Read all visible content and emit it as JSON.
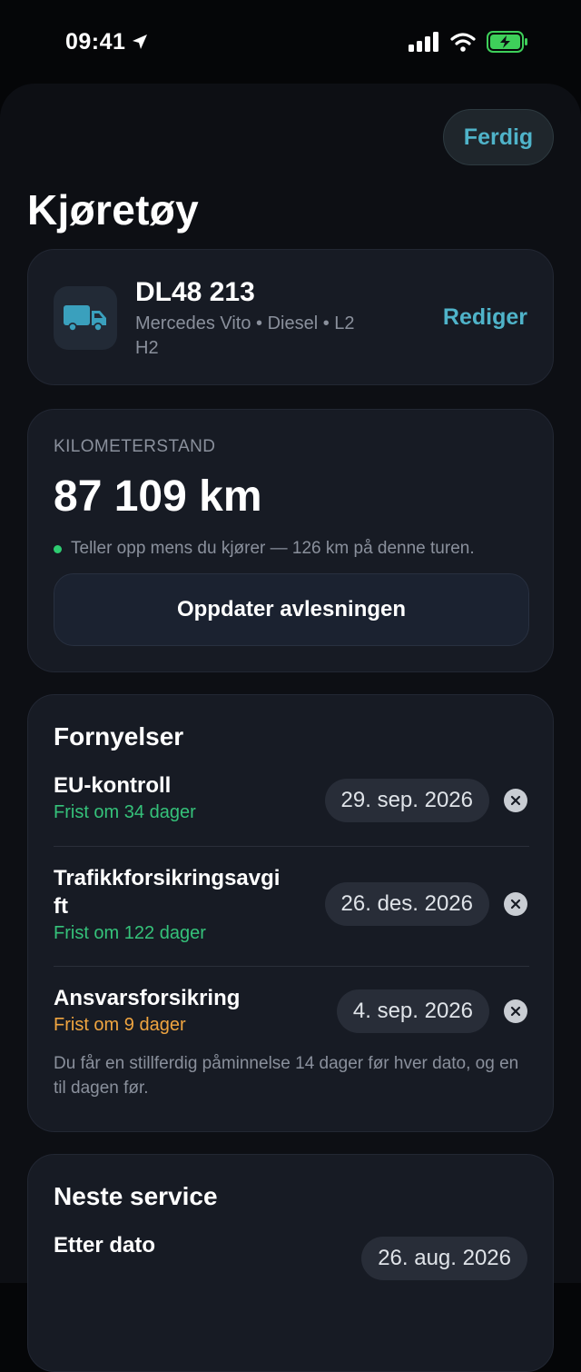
{
  "status_bar": {
    "time": "09:41"
  },
  "header": {
    "done_label": "Ferdig",
    "title": "Kjøretøy"
  },
  "vehicle": {
    "plate": "DL48 213",
    "description": "Mercedes Vito • Diesel • L2 H2",
    "edit_label": "Rediger",
    "accent_color": "#4fb3c9"
  },
  "odometer": {
    "label": "KILOMETERSTAND",
    "value": "87 109 km",
    "status": "Teller opp mens du kjører — 126 km på denne turen.",
    "update_label": "Oppdater avlesningen"
  },
  "renewals": {
    "title": "Fornyelser",
    "items": [
      {
        "name": "EU-kontroll",
        "due": "Frist om 34 dager",
        "date": "29. sep. 2026",
        "status_color": "#35c27a"
      },
      {
        "name": "Trafikkforsikringsavgift",
        "due": "Frist om 122 dager",
        "date": "26. des. 2026",
        "status_color": "#35c27a"
      },
      {
        "name": "Ansvarsforsikring",
        "due": "Frist om 9 dager",
        "date": "4. sep. 2026",
        "status_color": "#f0a540"
      }
    ],
    "note": "Du får en stillferdig påminnelse 14 dager før hver dato, og en til dagen før."
  },
  "next_service": {
    "title": "Neste service",
    "by_date_label": "Etter dato",
    "date": "26. aug. 2026"
  }
}
